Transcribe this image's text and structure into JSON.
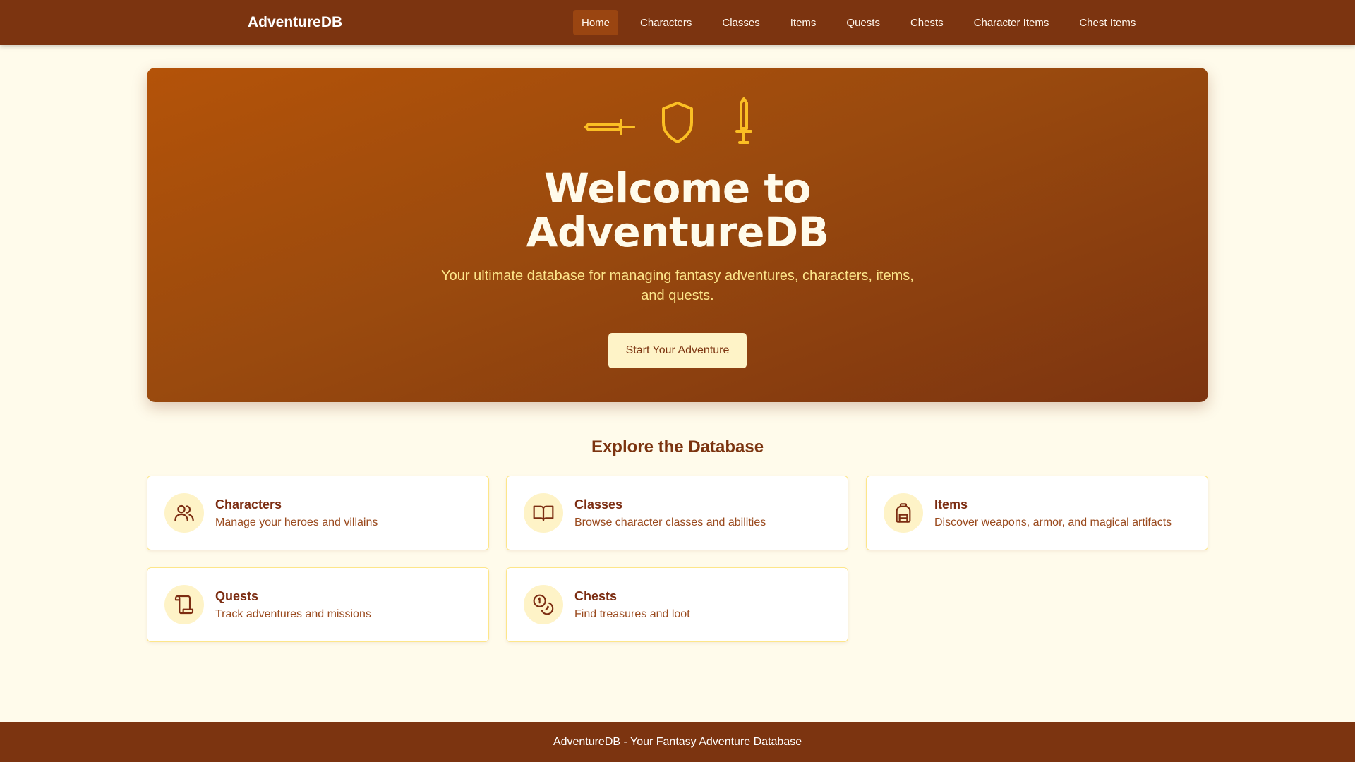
{
  "app": {
    "brand": "AdventureDB"
  },
  "nav": {
    "items": [
      {
        "label": "Home",
        "active": true
      },
      {
        "label": "Characters"
      },
      {
        "label": "Classes"
      },
      {
        "label": "Items"
      },
      {
        "label": "Quests"
      },
      {
        "label": "Chests"
      },
      {
        "label": "Character Items"
      },
      {
        "label": "Chest Items"
      }
    ]
  },
  "hero": {
    "icons": [
      "sword-icon",
      "shield-icon",
      "dagger-icon"
    ],
    "title_line1": "Welcome to",
    "title_line2": "AdventureDB",
    "subtitle": "Your ultimate database for managing fantasy adventures, characters, items, and quests.",
    "cta_label": "Start Your Adventure"
  },
  "explore": {
    "title": "Explore the Database",
    "cards": [
      {
        "title": "Characters",
        "description": "Manage your heroes and villains",
        "icon": "users-icon"
      },
      {
        "title": "Classes",
        "description": "Browse character classes and abilities",
        "icon": "book-open-icon"
      },
      {
        "title": "Items",
        "description": "Discover weapons, armor, and magical artifacts",
        "icon": "backpack-icon"
      },
      {
        "title": "Quests",
        "description": "Track adventures and missions",
        "icon": "scroll-icon"
      },
      {
        "title": "Chests",
        "description": "Find treasures and loot",
        "icon": "coins-icon"
      }
    ]
  },
  "footer": {
    "text": "AdventureDB - Your Fantasy Adventure Database"
  },
  "colors": {
    "header_bg": "#7c3410",
    "page_bg": "#fffbeb",
    "hero_gradient_start": "#b45309",
    "hero_gradient_end": "#7c3410",
    "accent_gold": "#fbbf24",
    "card_icon_bg": "#fef3c7"
  }
}
